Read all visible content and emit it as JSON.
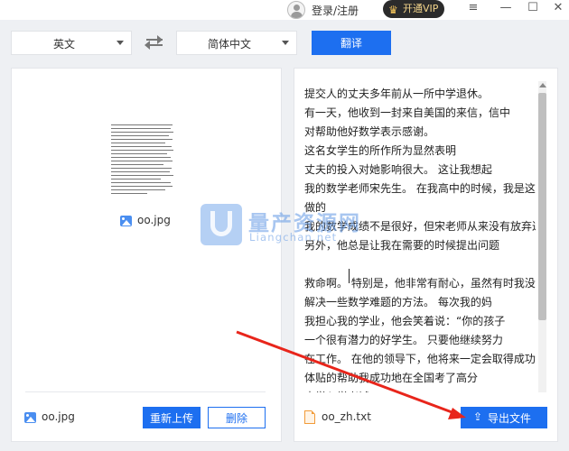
{
  "titlebar": {
    "login_label": "登录/注册",
    "vip_label": "开通VIP",
    "minimize_glyph": "—",
    "menu_glyph": "≡",
    "maximize_glyph": "☐",
    "close_glyph": "✕"
  },
  "toolbar": {
    "source_language": "英文",
    "target_language": "简体中文",
    "translate_label": "翻译"
  },
  "left_panel": {
    "preview_file_name": "oo.jpg",
    "footer_file_name": "oo.jpg",
    "reupload_label": "重新上传",
    "delete_label": "删除"
  },
  "right_panel": {
    "lines": [
      "提交人的丈夫多年前从一所中学退休。",
      "有一天，他收到一封来自美国的来信，信中",
      "对帮助他好数学表示感谢。",
      "这名女学生的所作所为显然表明",
      "丈夫的投入对她影响很大。 这让我想起",
      "我的数学老师宋先生。 在我高中的时候，我是这样",
      "做的",
      "我的数学成绩不是很好，但宋老师从来没有放弃过我。",
      "另外，他总是让我在需要的时候提出问题",
      "",
      "救命啊。 特别是，他非常有耐心，虽然有时我没有",
      "解决一些数学难题的方法。 每次我的妈",
      "我担心我的学业，他会笑着说：“你的孩子",
      "一个很有潜力的好学生。 只要他继续努力",
      "在工作。 在他的领导下，他将来一定会取得成功",
      "体贴的帮助我成功地在全国考了高分",
      "大学入学考试"
    ],
    "output_file_name": "oo_zh.txt",
    "export_label": "导出文件"
  },
  "watermark": {
    "title": "量产资源网",
    "subtitle": "Liangchan.net"
  },
  "colors": {
    "accent": "#1d6ff0",
    "annotation_arrow": "#e8251b"
  },
  "icons": {
    "user": "avatar-icon",
    "vip": "crown-icon",
    "swap": "swap-arrows-icon",
    "image": "image-file-icon",
    "text_file": "text-file-icon",
    "export": "export-icon"
  }
}
